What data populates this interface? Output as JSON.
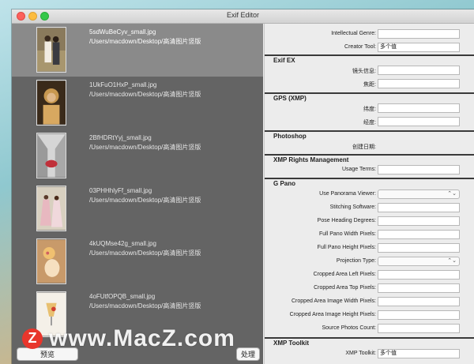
{
  "window": {
    "title": "Exif Editor"
  },
  "files": [
    {
      "name": "5sdWuBeCyv_small.jpg",
      "path": "/Users/macdown/Desktop/高清图片竖版",
      "selected": true
    },
    {
      "name": "1UkFuO1HxP_small.jpg",
      "path": "/Users/macdown/Desktop/高清图片竖版",
      "selected": false
    },
    {
      "name": "2BfHDRtYyj_small.jpg",
      "path": "/Users/macdown/Desktop/高清图片竖版",
      "selected": false
    },
    {
      "name": "03PHHhlyFf_small.jpg",
      "path": "/Users/macdown/Desktop/高清图片竖版",
      "selected": false
    },
    {
      "name": "4kUQMse42g_small.jpg",
      "path": "/Users/macdown/Desktop/高清图片竖版",
      "selected": false
    },
    {
      "name": "4oFUtfOPQB_small.jpg",
      "path": "/Users/macdown/Desktop/高清图片竖版",
      "selected": false
    }
  ],
  "buttons": {
    "preview": "预览",
    "process": "处理"
  },
  "iptc": {
    "intellectual_genre_label": "Intellectual Genre:",
    "creator_tool_label": "Creator Tool:",
    "creator_tool_value": "多个值"
  },
  "exif_ex": {
    "title": "Exif EX",
    "lens_info": "镜头信息:",
    "focal": "焦距:"
  },
  "gps": {
    "title": "GPS (XMP)",
    "lat": "纬度:",
    "lon": "经度:"
  },
  "photoshop": {
    "title": "Photoshop",
    "date_created": "创建日期:"
  },
  "rights": {
    "title": "XMP Rights Management",
    "usage_terms": "Usage Terms:"
  },
  "gpano": {
    "title": "G Pano",
    "use_viewer": "Use Panorama Viewer:",
    "stitching": "Stitching Software:",
    "pose_heading": "Pose Heading Degrees:",
    "full_width": "Full Pano Width Pixels:",
    "full_height": "Full Pano Height Pixels:",
    "projection": "Projection Type:",
    "crop_left": "Cropped Area Left Pixels:",
    "crop_top": "Cropped Area Top Pixels:",
    "crop_img_w": "Cropped Area Image Width Pixels:",
    "crop_img_h": "Cropped Area Image Height Pixels:",
    "source_count": "Source Photos Count:"
  },
  "toolkit": {
    "title": "XMP Toolkit",
    "label": "XMP Toolkit:",
    "value": "多个值"
  },
  "watermark": {
    "logo": "Z",
    "text": "www.MacZ.com"
  },
  "colors": {
    "selected_row": "#8a8a8a",
    "list_bg": "#646464",
    "accent": "#e8362c"
  }
}
